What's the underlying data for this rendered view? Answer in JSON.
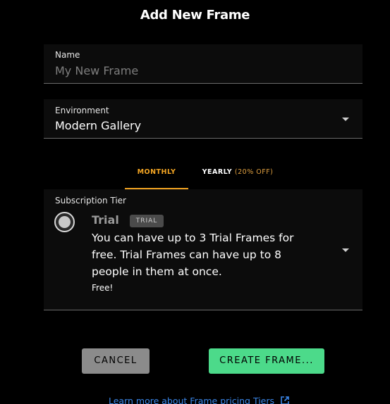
{
  "dialog": {
    "title": "Add New Frame"
  },
  "name_field": {
    "label": "Name",
    "placeholder": "My New Frame",
    "value": ""
  },
  "environment_field": {
    "label": "Environment",
    "selected": "Modern Gallery"
  },
  "billing_tabs": {
    "monthly": "MONTHLY",
    "yearly": "YEARLY",
    "yearly_discount": "(20% OFF)",
    "active": "monthly"
  },
  "subscription": {
    "label": "Subscription Tier",
    "tier_name": "Trial",
    "tier_badge": "TRIAL",
    "description": "You can have up to 3 Trial Frames for free. Trial Frames can have up to 8 people in them at once.",
    "price": "Free!"
  },
  "actions": {
    "cancel": "CANCEL",
    "create": "CREATE FRAME..."
  },
  "footer": {
    "learn_more": "Learn more about Frame pricing Tiers"
  },
  "colors": {
    "accent_tab": "#f5a623",
    "create_button": "#4cda8a",
    "cancel_button": "#8b8b8b",
    "link": "#3a86e8"
  },
  "icons": {
    "dropdown": "chevron-down-icon",
    "external": "external-link-icon"
  }
}
